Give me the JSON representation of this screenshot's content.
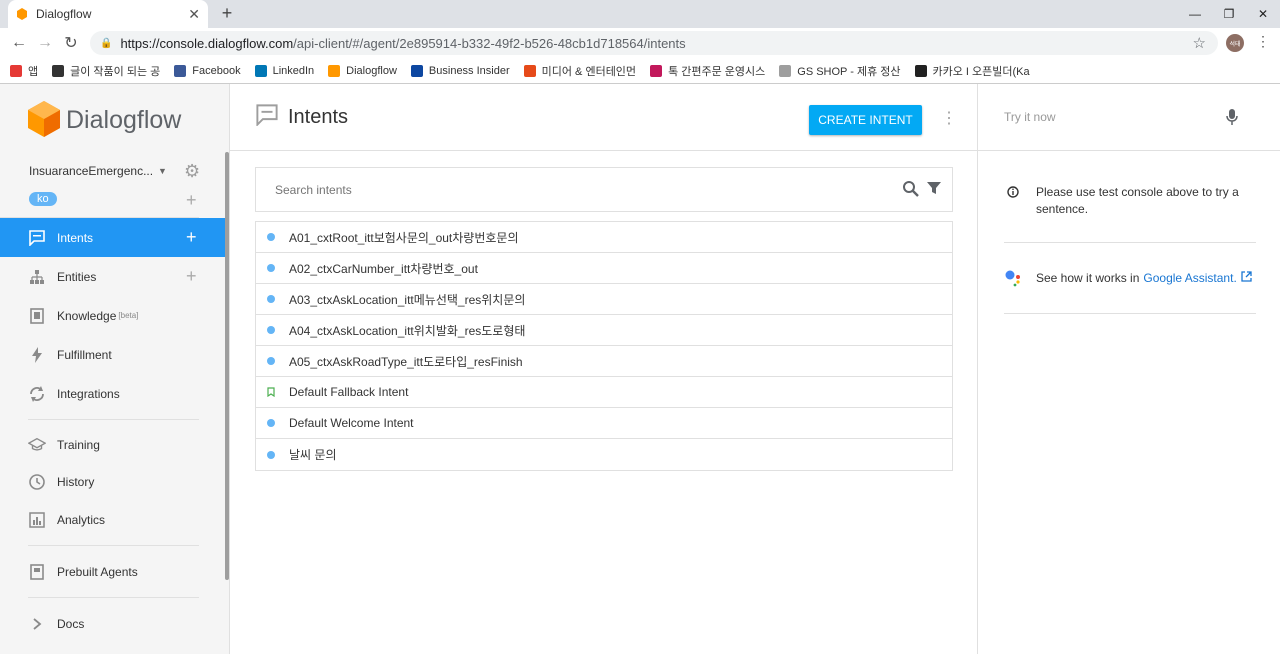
{
  "browser": {
    "tab_title": "Dialogflow",
    "url_host": "https://console.dialogflow.com",
    "url_path": "/api-client/#/agent/2e895914-b332-49f2-b526-48cb1d718564/intents",
    "avatar_text": "석태",
    "bookmarks": [
      {
        "label": "앱",
        "color": "#e53935"
      },
      {
        "label": "글이 작품이 되는 공",
        "color": "#333333"
      },
      {
        "label": "Facebook",
        "color": "#3b5998"
      },
      {
        "label": "LinkedIn",
        "color": "#0077b5"
      },
      {
        "label": "Dialogflow",
        "color": "#ff9800"
      },
      {
        "label": "Business Insider",
        "color": "#0d47a1"
      },
      {
        "label": "미디어 & 엔터테인먼",
        "color": "#e64a19"
      },
      {
        "label": "톡 간편주문 운영시스",
        "color": "#c2185b"
      },
      {
        "label": "GS SHOP - 제휴 정산",
        "color": "#9e9e9e"
      },
      {
        "label": "카카오 I 오픈빌더(Ka",
        "color": "#212121"
      }
    ]
  },
  "brand": {
    "name": "Dialogflow"
  },
  "agent": {
    "name": "InsuaranceEmergenc...",
    "language": "ko"
  },
  "nav": {
    "intents": "Intents",
    "entities": "Entities",
    "knowledge": "Knowledge",
    "knowledge_badge": "[beta]",
    "fulfillment": "Fulfillment",
    "integrations": "Integrations",
    "training": "Training",
    "history": "History",
    "analytics": "Analytics",
    "prebuilt": "Prebuilt Agents",
    "docs": "Docs"
  },
  "main": {
    "title": "Intents",
    "create_label": "CREATE INTENT",
    "search_placeholder": "Search intents",
    "intents": [
      {
        "name": "A01_cxtRoot_itt보험사문의_out차량번호문의",
        "kind": "dot"
      },
      {
        "name": "A02_ctxCarNumber_itt차량번호_out",
        "kind": "dot"
      },
      {
        "name": "A03_ctxAskLocation_itt메뉴선택_res위치문의",
        "kind": "dot"
      },
      {
        "name": "A04_ctxAskLocation_itt위치발화_res도로형태",
        "kind": "dot"
      },
      {
        "name": "A05_ctxAskRoadType_itt도로타입_resFinish",
        "kind": "dot"
      },
      {
        "name": "Default Fallback Intent",
        "kind": "bookmark"
      },
      {
        "name": "Default Welcome Intent",
        "kind": "dot"
      },
      {
        "name": "날씨 문의",
        "kind": "dot"
      }
    ]
  },
  "console": {
    "try_placeholder": "Try it now",
    "info_text": "Please use test console above to try a sentence.",
    "ga_prefix": "See how it works in",
    "ga_link": "Google Assistant."
  },
  "colors": {
    "accent": "#2196f3",
    "button": "#03a9f4",
    "bullet": "#64b5f6"
  }
}
